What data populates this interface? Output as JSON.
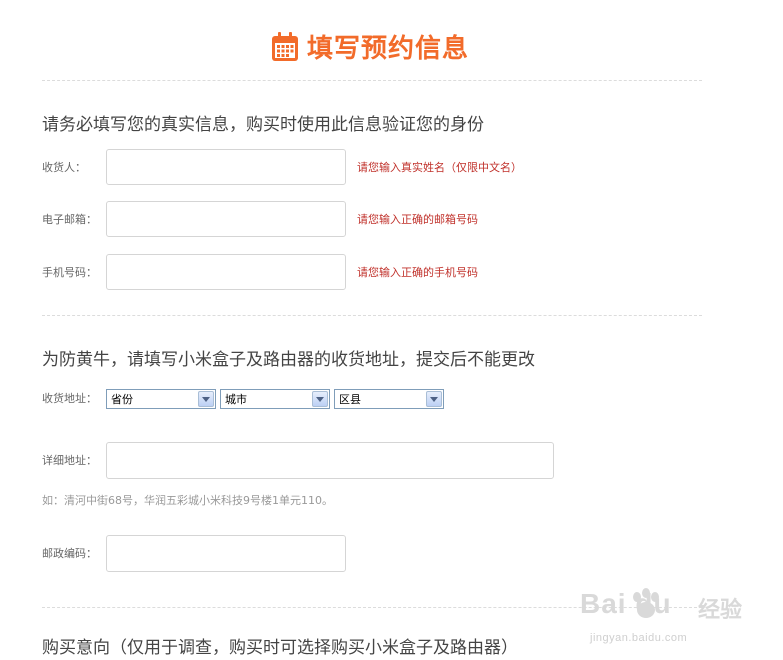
{
  "header": {
    "title": "填写预约信息",
    "icon": "calendar-icon",
    "accent_color": "#f26b2a"
  },
  "section1": {
    "heading": "请务必填写您的真实信息，购买时使用此信息验证您的身份",
    "fields": [
      {
        "label": "收货人：",
        "value": "",
        "hint": "请您输入真实姓名（仅限中文名）"
      },
      {
        "label": "电子邮箱：",
        "value": "",
        "hint": "请您输入正确的邮箱号码"
      },
      {
        "label": "手机号码：",
        "value": "",
        "hint": "请您输入正确的手机号码"
      }
    ]
  },
  "section2": {
    "heading": "为防黄牛，请填写小米盒子及路由器的收货地址，提交后不能更改",
    "region_label": "收货地址：",
    "selects": [
      {
        "value": "省份"
      },
      {
        "value": "城市"
      },
      {
        "value": "区县"
      }
    ],
    "detail_label": "详细地址：",
    "detail_value": "",
    "example": "如：清河中街68号，华润五彩城小米科技9号楼1单元110。",
    "postcode_label": "邮政编码：",
    "postcode_value": ""
  },
  "section3": {
    "heading": "购买意向（仅用于调查，购买时可选择购买小米盒子及路由器）"
  },
  "watermark": {
    "brand": "Bai du",
    "name": "经验",
    "url": "jingyan.baidu.com"
  },
  "colors": {
    "hint_red": "#c0312b",
    "border": "#d5d5d5",
    "divider": "#dcdcdc"
  }
}
